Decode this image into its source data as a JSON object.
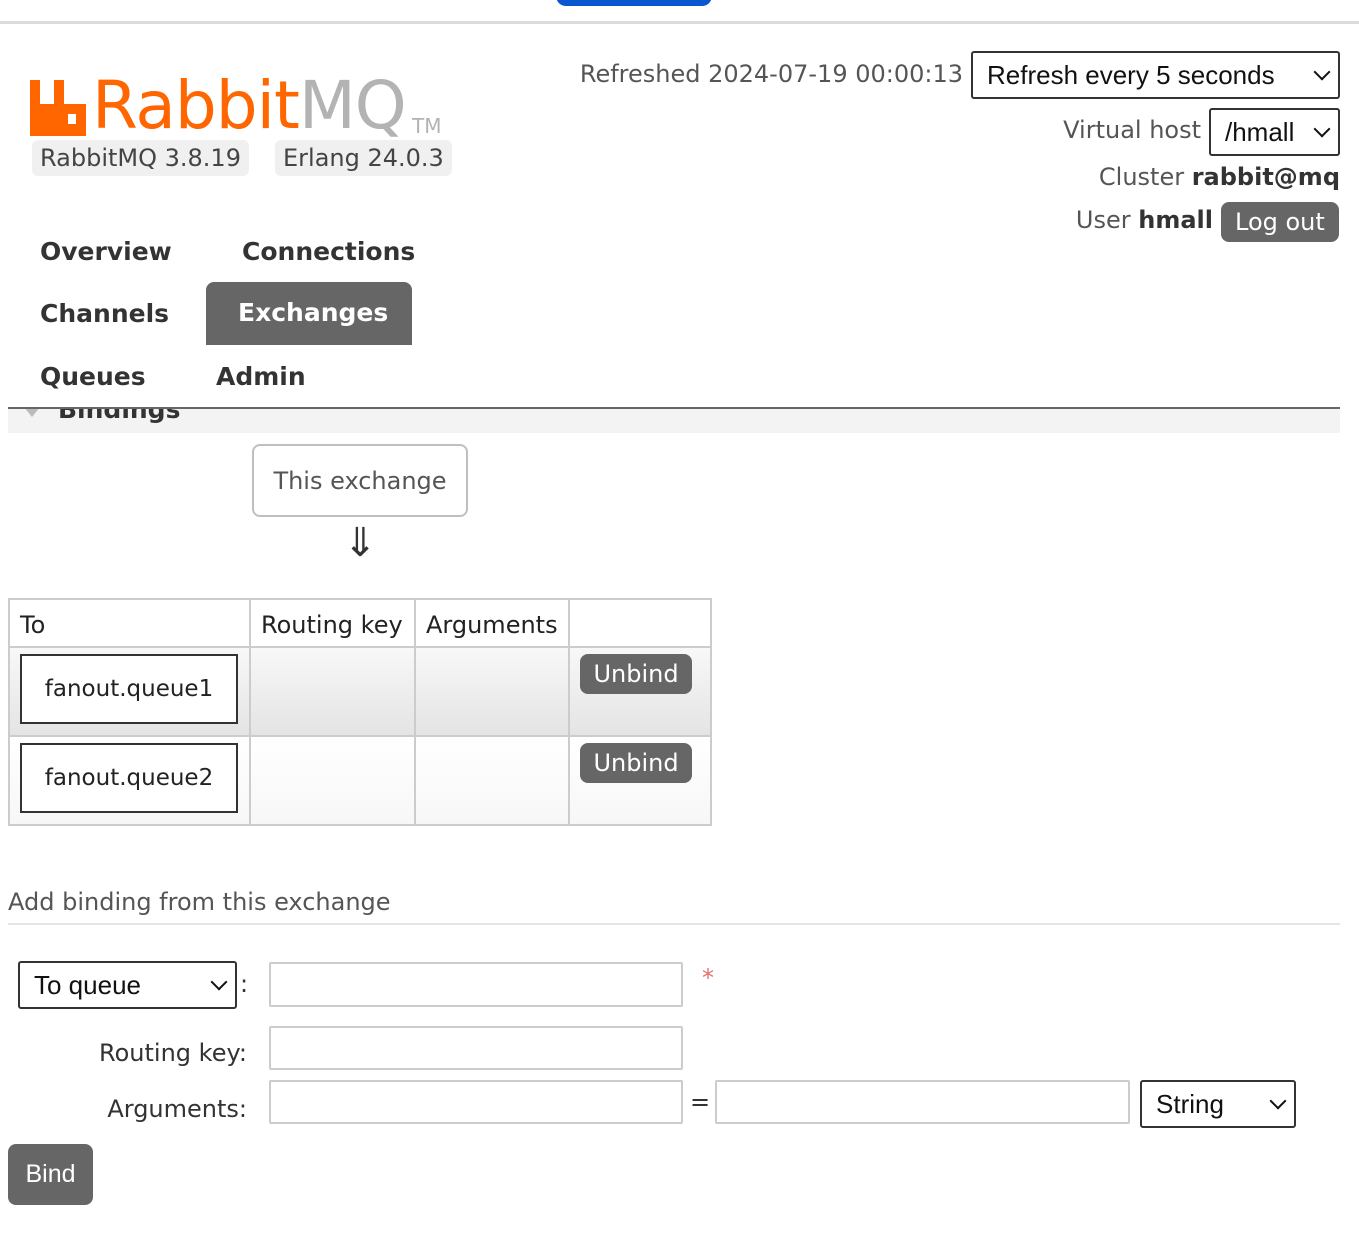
{
  "header": {
    "logo_text_primary": "Rabbit",
    "logo_text_secondary": "MQ",
    "logo_tm": "TM",
    "rabbitmq_version": "RabbitMQ 3.8.19",
    "erlang_version": "Erlang 24.0.3",
    "refreshed_label": "Refreshed 2024-07-19 00:00:13",
    "refresh_select": "Refresh every 5 seconds",
    "vhost_label": "Virtual host",
    "vhost_select": "/hmall",
    "cluster_label": "Cluster",
    "cluster_name": "rabbit@mq",
    "user_label": "User",
    "user_name": "hmall",
    "logout_label": "Log out"
  },
  "nav": {
    "overview": "Overview",
    "connections": "Connections",
    "channels": "Channels",
    "exchanges": "Exchanges",
    "queues": "Queues",
    "admin": "Admin",
    "active": "Exchanges"
  },
  "bindings": {
    "section_title": "Bindings",
    "source_label": "This exchange",
    "arrow": "⇓",
    "columns": [
      "To",
      "Routing key",
      "Arguments",
      ""
    ],
    "rows": [
      {
        "to": "fanout.queue1",
        "routing_key": "",
        "arguments": "",
        "action": "Unbind"
      },
      {
        "to": "fanout.queue2",
        "routing_key": "",
        "arguments": "",
        "action": "Unbind"
      }
    ]
  },
  "add_binding": {
    "title": "Add binding from this exchange",
    "destination_type": "To queue",
    "destination_colon": ":",
    "destination_value": "",
    "required_mark": "*",
    "routing_key_label": "Routing key:",
    "routing_key_value": "",
    "arguments_label": "Arguments:",
    "argument_key": "",
    "equals": "=",
    "argument_value": "",
    "argument_type": "String",
    "bind_label": "Bind"
  },
  "colors": {
    "brand_orange": "#ff6600",
    "logo_gray": "#b3b3b3",
    "button_gray": "#666666",
    "top_pill_blue": "#0b57d0"
  }
}
